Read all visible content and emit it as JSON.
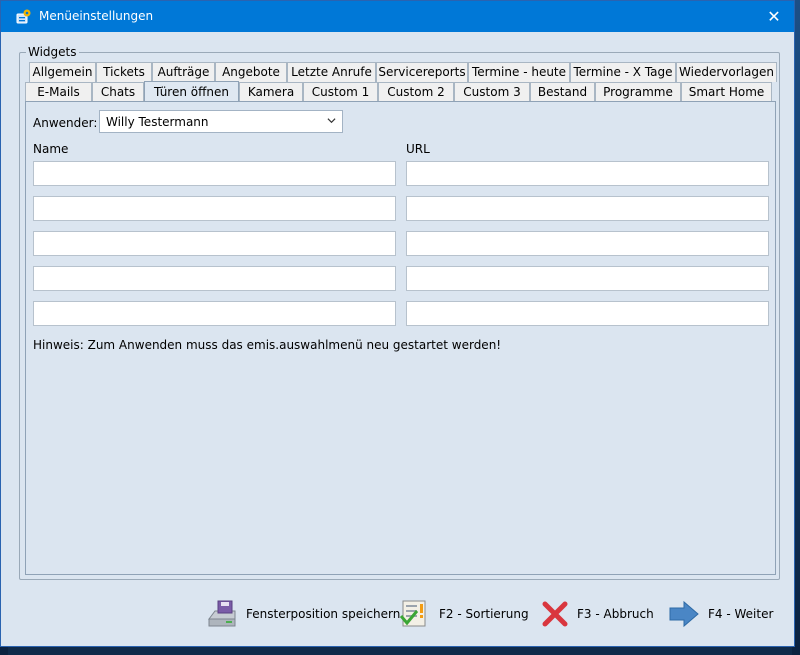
{
  "window": {
    "title": "Menüeinstellungen",
    "close_glyph": "✕"
  },
  "group": {
    "legend": "Widgets"
  },
  "tabs": {
    "row1": [
      "Allgemein",
      "Tickets",
      "Aufträge",
      "Angebote",
      "Letzte Anrufe",
      "Servicereports",
      "Termine - heute",
      "Termine - X Tage",
      "Wiedervorlagen"
    ],
    "row2": [
      "E-Mails",
      "Chats",
      "Türen öffnen",
      "Kamera",
      "Custom 1",
      "Custom 2",
      "Custom 3",
      "Bestand",
      "Programme",
      "Smart Home"
    ],
    "active": "Türen öffnen"
  },
  "form": {
    "user_label": "Anwender:",
    "user_value": "Willy Testermann",
    "name_header": "Name",
    "url_header": "URL",
    "rows": [
      {
        "name": "",
        "url": ""
      },
      {
        "name": "",
        "url": ""
      },
      {
        "name": "",
        "url": ""
      },
      {
        "name": "",
        "url": ""
      },
      {
        "name": "",
        "url": ""
      }
    ],
    "hint": "Hinweis: Zum Anwenden muss das emis.auswahlmenü neu gestartet werden!"
  },
  "footer": {
    "save": "Fensterposition speichern",
    "sort": "F2 - Sortierung",
    "cancel": "F3 - Abbruch",
    "next": "F4 - Weiter"
  },
  "icons": {
    "app": "settings-app-icon",
    "save": "disk-drive-icon",
    "sort": "checklist-icon",
    "cancel": "red-x-icon",
    "next": "blue-arrow-right-icon"
  },
  "colors": {
    "titlebar": "#0078d7",
    "dialog_bg": "#dbe5f0",
    "cancel_red": "#d9363e",
    "arrow_blue": "#4a86c5"
  }
}
